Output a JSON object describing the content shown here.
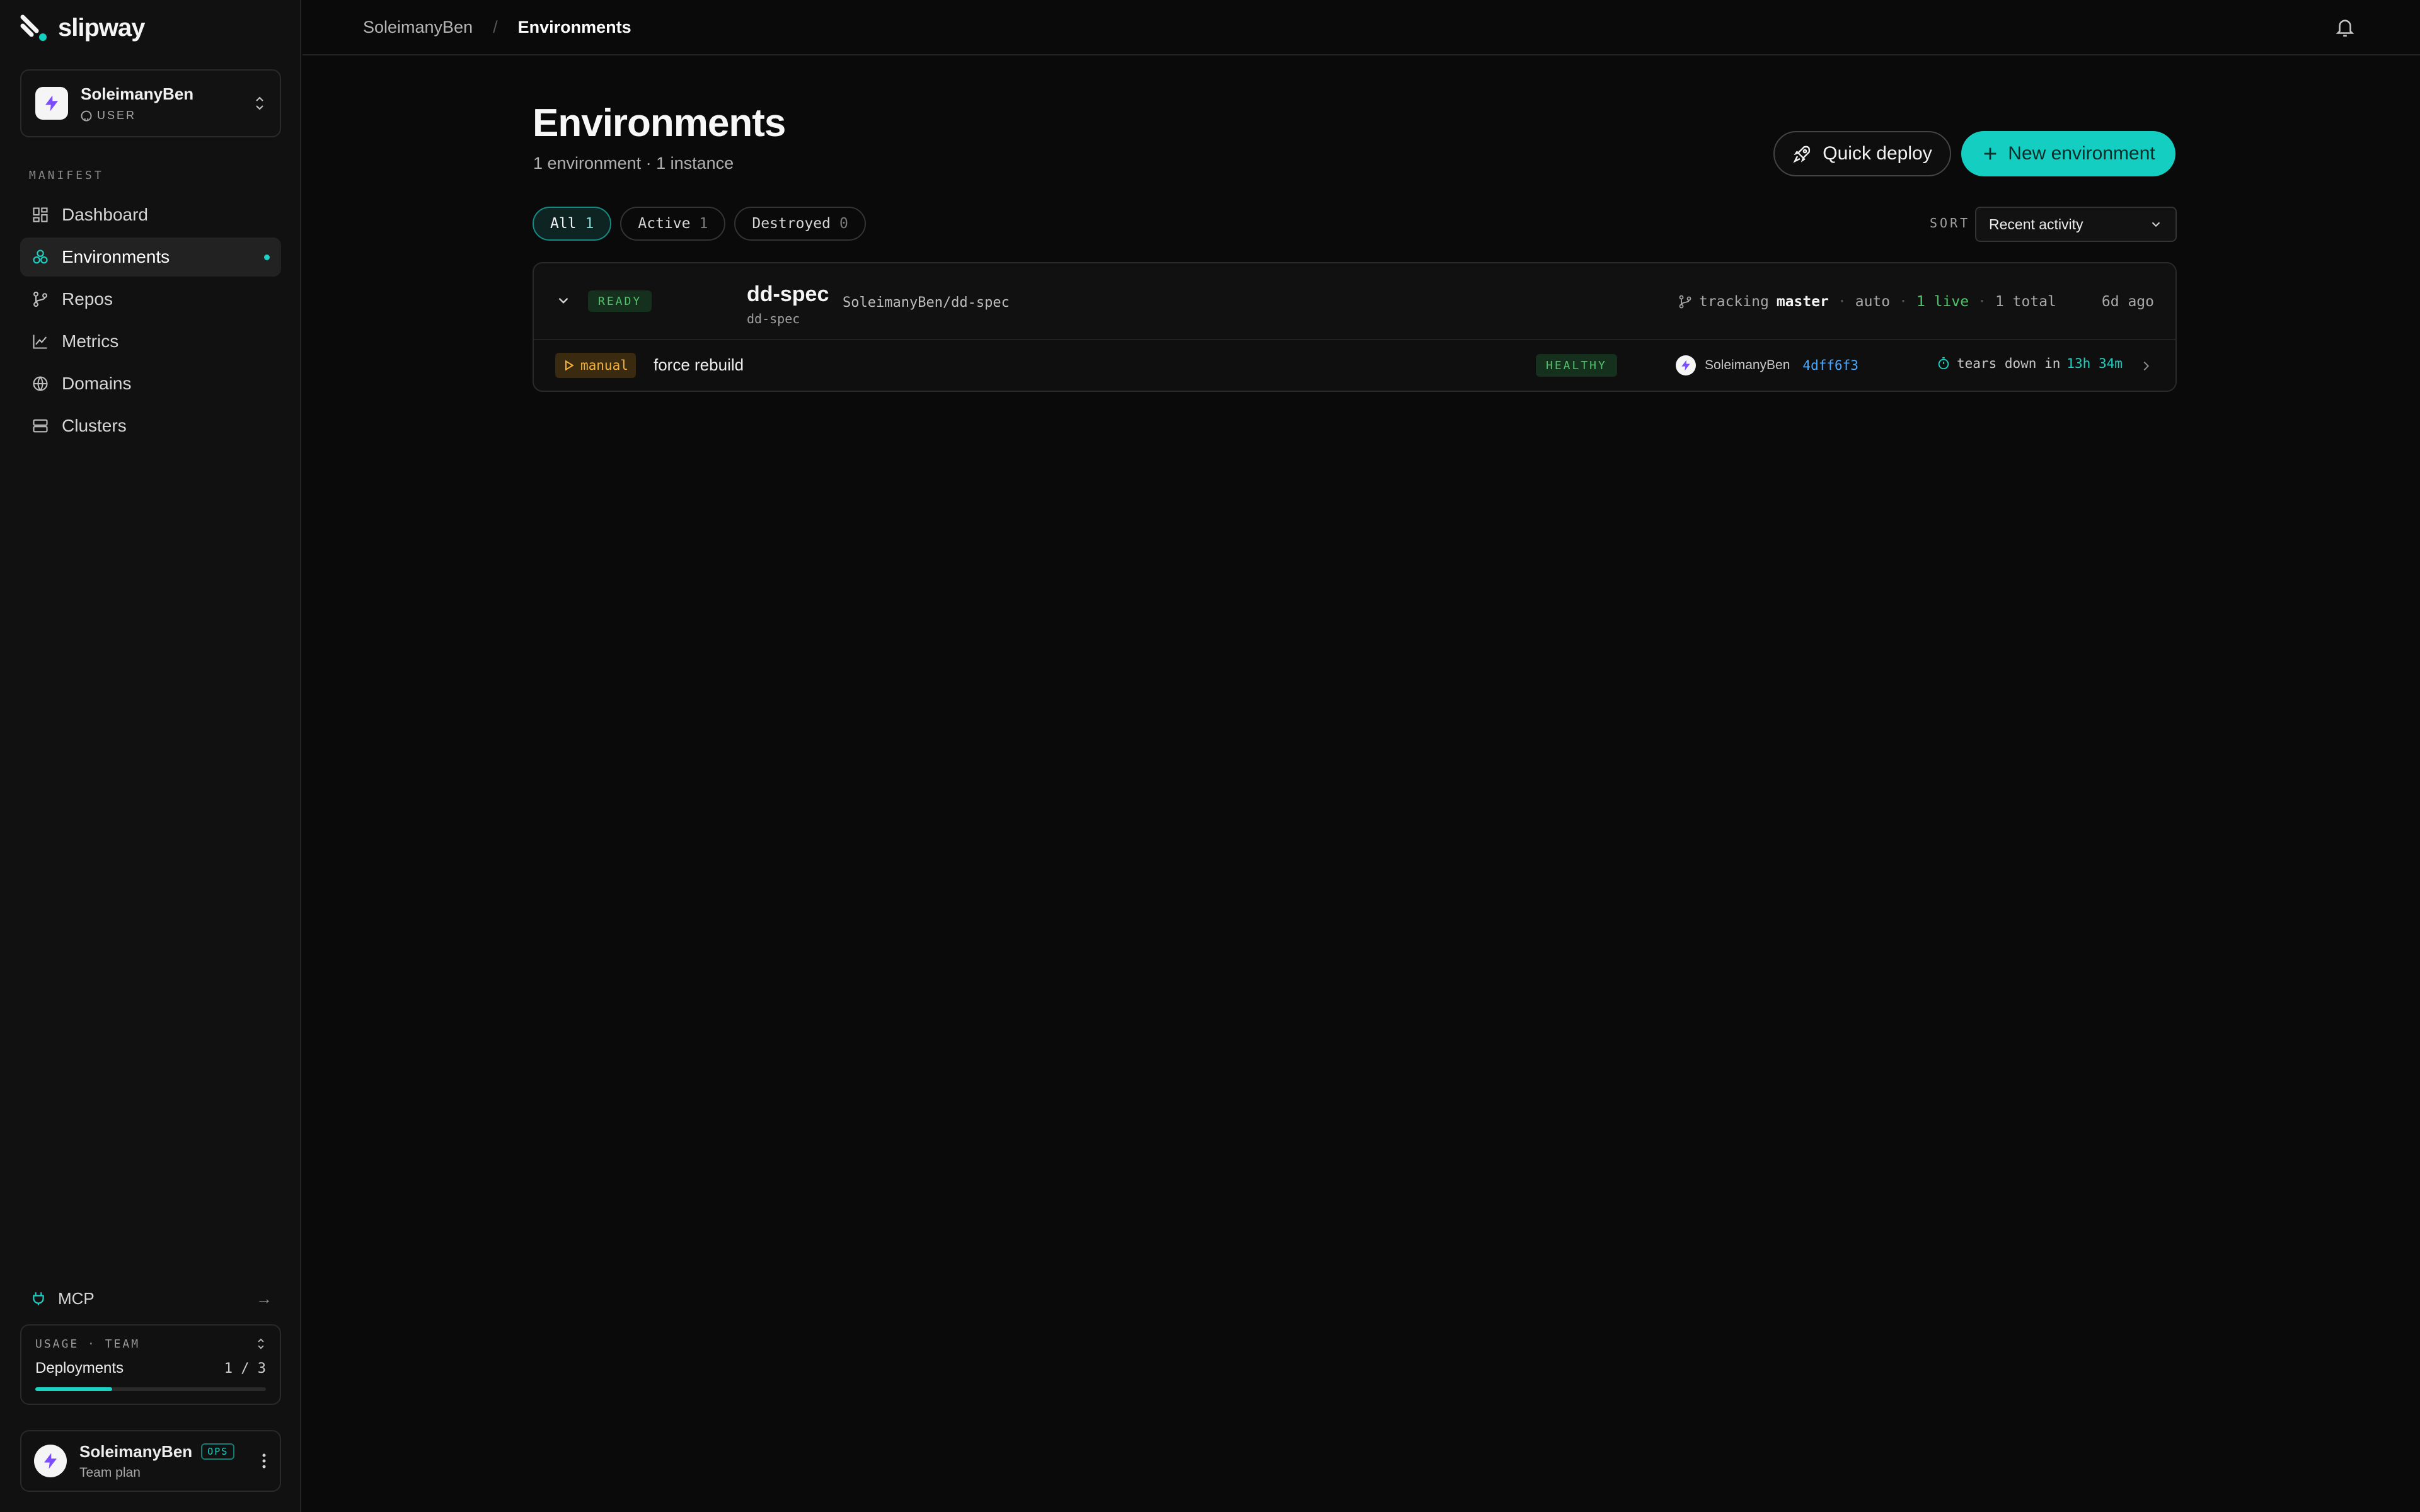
{
  "app": {
    "brand": "slipway",
    "accent": "#14cfc1"
  },
  "account": {
    "name": "SoleimanyBen",
    "role": "USER",
    "icon": "lightning-icon"
  },
  "sidebar": {
    "section_label": "MANIFEST",
    "items": [
      {
        "label": "Dashboard",
        "icon": "dashboard-icon"
      },
      {
        "label": "Environments",
        "icon": "environments-icon",
        "active": true
      },
      {
        "label": "Repos",
        "icon": "git-branch-icon"
      },
      {
        "label": "Metrics",
        "icon": "chart-icon"
      },
      {
        "label": "Domains",
        "icon": "globe-icon"
      },
      {
        "label": "Clusters",
        "icon": "server-icon"
      }
    ],
    "mcp_label": "MCP",
    "usage": {
      "title": "USAGE · TEAM",
      "metric_label": "Deployments",
      "count": "1 / 3",
      "fraction": 0.333
    },
    "user": {
      "name": "SoleimanyBen",
      "badge": "OPS",
      "plan": "Team plan"
    }
  },
  "topbar": {
    "breadcrumb_parent": "SoleimanyBen",
    "breadcrumb_sep": "/",
    "breadcrumb_current": "Environments"
  },
  "main": {
    "title": "Environments",
    "subtitle": "1 environment · 1 instance",
    "quick_deploy_label": "Quick deploy",
    "new_env_label": "New environment",
    "filters": [
      {
        "label": "All",
        "count": "1",
        "active": true
      },
      {
        "label": "Active",
        "count": "1"
      },
      {
        "label": "Destroyed",
        "count": "0"
      }
    ],
    "sort_label": "SORT",
    "sort_value": "Recent activity"
  },
  "environment": {
    "status": "READY",
    "name": "dd-spec",
    "slug": "dd-spec",
    "repo": "SoleimanyBen/dd-spec",
    "tracking_label": "tracking",
    "branch": "master",
    "mode": "auto",
    "live": "1 live",
    "total": "1 total",
    "updated": "6d ago",
    "instance": {
      "trigger": "manual",
      "label": "force rebuild",
      "health": "HEALTHY",
      "author": "SoleimanyBen",
      "commit": "4dff6f3",
      "teardown_label": "tears down in",
      "teardown_time": "13h 34m"
    }
  }
}
